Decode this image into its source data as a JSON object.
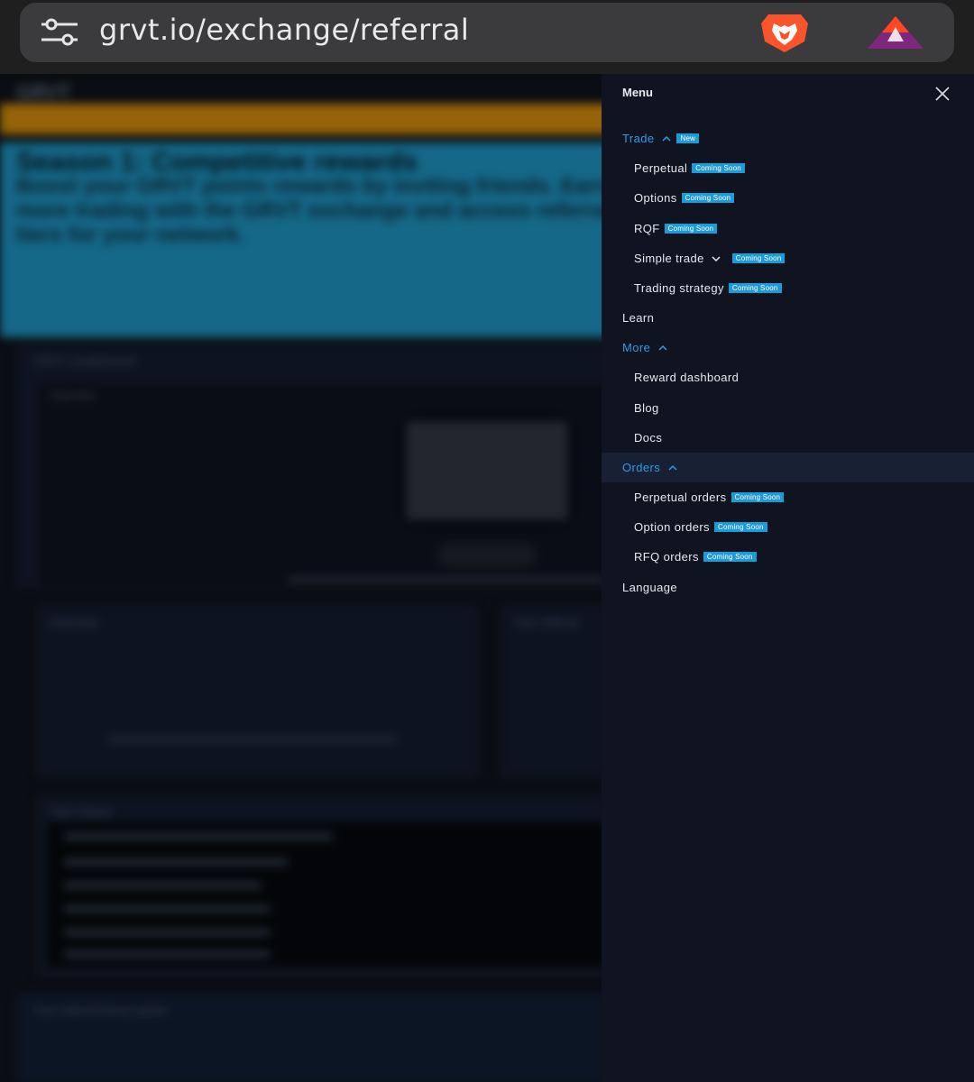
{
  "browser": {
    "url": "grvt.io/exchange/referral",
    "icons": [
      "tune-icon",
      "brave-lion-icon",
      "bat-triangle-icon"
    ]
  },
  "background_page": {
    "logo": "GRVT",
    "hero_title": "Season 1: Competitive rewards",
    "hero_text": "Boost your GRVT points rewards by inviting friends. Earn more trading with the GRVT exchange and access referral tiers for your network.",
    "card1_title": "GRVT Leaderboard",
    "card2_title": "Your box",
    "card3_title": "Overview",
    "card4_title": "Your referral",
    "card5_title": "Task history",
    "card6_title": "Your referral bonus points"
  },
  "menu": {
    "title": "Menu",
    "close_icon": "close-icon",
    "accent_color": "#2e9be6",
    "badge_color": "#1d9ad8",
    "trade": {
      "label": "Trade",
      "badge": "New"
    },
    "trade_items": [
      {
        "label": "Perpetual",
        "badge": "Coming Soon"
      },
      {
        "label": "Options",
        "badge": "Coming Soon"
      },
      {
        "label": "RQF",
        "badge": "Coming Soon"
      },
      {
        "label": "Simple trade",
        "badge": "Coming Soon"
      },
      {
        "label": "Trading strategy",
        "badge": "Coming Soon"
      }
    ],
    "learn": {
      "label": "Learn"
    },
    "more": {
      "label": "More"
    },
    "more_items": [
      {
        "label": "Reward dashboard"
      },
      {
        "label": "Blog"
      },
      {
        "label": "Docs"
      }
    ],
    "orders": {
      "label": "Orders"
    },
    "orders_items": [
      {
        "label": "Perpetual orders",
        "badge": "Coming Soon"
      },
      {
        "label": "Option orders",
        "badge": "Coming Soon"
      },
      {
        "label": "RFQ orders",
        "badge": "Coming Soon"
      }
    ],
    "language": {
      "label": "Language"
    }
  }
}
